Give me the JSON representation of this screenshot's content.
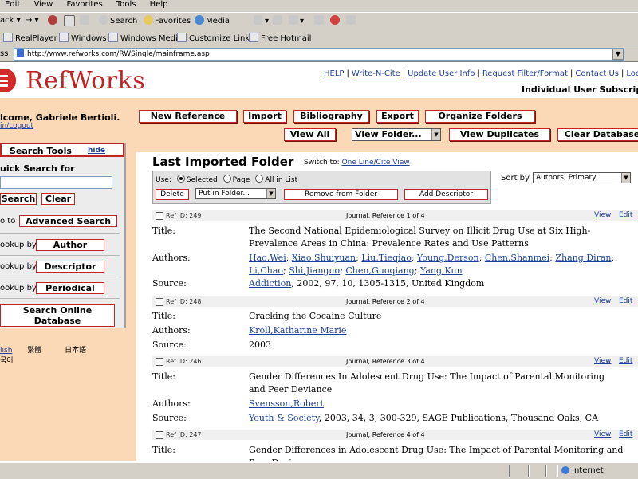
{
  "browser": {
    "menu": [
      "Edit",
      "View",
      "Favorites",
      "Tools",
      "Help"
    ],
    "toolbar": {
      "back": "ack",
      "search": "Search",
      "favorites": "Favorites",
      "media": "Media"
    },
    "links": [
      "RealPlayer",
      "Windows",
      "Windows Media",
      "Customize Links",
      "Free Hotmail"
    ],
    "address_label": "ss",
    "url": "http://www.refworks.com/RWSingle/mainframe.asp",
    "status_zone": "Internet"
  },
  "header": {
    "logo": "RefWorks",
    "top_links": [
      "HELP",
      "Write-N-Cite",
      "Update User Info",
      "Request Filter/Format",
      "Contact Us",
      "Logo"
    ],
    "subscription": "Individual User Subscription",
    "welcome": "lcome, Gabriele Bertioli.",
    "logout": "in/Logout"
  },
  "nav": {
    "new_reference": "New Reference",
    "import": "Import",
    "bibliography": "Bibliography",
    "export": "Export",
    "organize_folders": "Organize Folders",
    "view_all": "View All",
    "view_folder": "View Folder...",
    "view_duplicates": "View Duplicates",
    "clear_database": "Clear Database"
  },
  "sidebar": {
    "title": "Search Tools",
    "hide": "hide",
    "quick_search_label": "uick Search for",
    "quick_search_value": "",
    "search_btn": "Search",
    "clear_btn": "Clear",
    "goto_label": "o to",
    "advanced_search": "Advanced Search",
    "lookups": [
      {
        "label": "ookup by",
        "button": "Author"
      },
      {
        "label": "ookup by",
        "button": "Descriptor"
      },
      {
        "label": "ookup by",
        "button": "Periodical"
      }
    ],
    "search_online": "Search Online Database",
    "lang_links": [
      "lish",
      "繁體",
      "日本語"
    ],
    "lang_extra": "국어"
  },
  "main": {
    "title": "Last Imported Folder",
    "switch_label": "Switch to:",
    "switch_link": "One Line/Cite View",
    "use_label": "Use:",
    "radio_selected": "Selected",
    "radio_page": "Page",
    "radio_all": "All in List",
    "delete_btn": "Delete",
    "put_in_folder": "Put in Folder...",
    "remove_from_folder": "Remove from Folder",
    "add_descriptor": "Add Descriptor",
    "sort_by_label": "Sort by",
    "sort_by_value": "Authors, Primary",
    "view_label": "View",
    "edit_label": "Edit",
    "field_title": "Title:",
    "field_authors": "Authors:",
    "field_source": "Source:",
    "references": [
      {
        "ref_id": "Ref ID: 249",
        "ref_type": "Journal, Reference 1 of 4",
        "title": "The Second National Epidemiological Survey on Illicit Drug Use at Six High-Prevalence Areas in China: Prevalence Rates and Use Patterns",
        "authors": [
          "Hao,Wei",
          "Xiao,Shuiyuan",
          "Liu,Tieqiao",
          "Young,Derson",
          "Chen,Shanmei",
          "Zhang,Diran",
          "Li,Chao",
          "Shi,Jianguo",
          "Chen,Guoqiang",
          "Yang,Kun"
        ],
        "source_link": "Addiction",
        "source_rest": ", 2002, 97, 10, 1305-1315, United Kingdom"
      },
      {
        "ref_id": "Ref ID: 248",
        "ref_type": "Journal, Reference 2 of 4",
        "title": "Cracking the Cocaine Culture",
        "authors": [
          "Kroll,Katharine Marie"
        ],
        "source_link": "",
        "source_rest": "2003"
      },
      {
        "ref_id": "Ref ID: 246",
        "ref_type": "Journal, Reference 3 of 4",
        "title": "Gender Differences In Adolescent Drug Use: The Impact of Parental Monitoring and Peer Deviance",
        "authors": [
          "Svensson,Robert"
        ],
        "source_link": "Youth & Society",
        "source_rest": ", 2003, 34, 3, 300-329, SAGE Publications, Thousand Oaks, CA"
      },
      {
        "ref_id": "Ref ID: 247",
        "ref_type": "Journal, Reference 4 of 4",
        "title": "Gender Differences in Adolescent Drug Use: The Impact of Parental Monitoring and Peer Deviance",
        "authors": [],
        "source_link": "",
        "source_rest": ""
      }
    ]
  },
  "colors": {
    "brand_red": "#c02424",
    "peach": "#fbd9b6",
    "link": "#1a3f9c"
  }
}
